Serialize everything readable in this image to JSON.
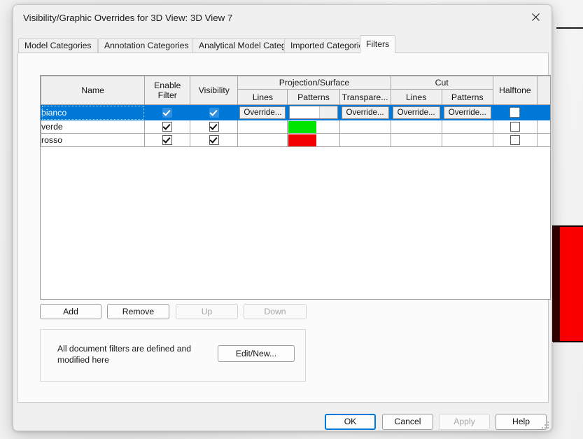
{
  "window": {
    "title": "Visibility/Graphic Overrides for 3D View: 3D View 7",
    "close_icon": "close-icon"
  },
  "tabs": [
    {
      "label": "Model Categories",
      "active": false
    },
    {
      "label": "Annotation Categories",
      "active": false
    },
    {
      "label": "Analytical Model Categories",
      "active": false
    },
    {
      "label": "Imported Categories",
      "active": false
    },
    {
      "label": "Filters",
      "active": true
    }
  ],
  "grid": {
    "group_headers": {
      "name": "Name",
      "enable_filter": "Enable\nFilter",
      "enable_filter_line1": "Enable",
      "enable_filter_line2": "Filter",
      "visibility": "Visibility",
      "projection_surface": "Projection/Surface",
      "cut": "Cut",
      "halftone": "Halftone"
    },
    "sub_headers": {
      "proj_lines": "Lines",
      "proj_patterns": "Patterns",
      "proj_transparency": "Transpare...",
      "cut_lines": "Lines",
      "cut_patterns": "Patterns"
    },
    "override_label": "Override...",
    "rows": [
      {
        "name": "bianco",
        "selected": true,
        "enable_filter": true,
        "visibility": true,
        "proj_lines": "Override...",
        "proj_patterns_swatch": "#ffffff",
        "proj_patterns_is_button": true,
        "proj_transparency": "Override...",
        "cut_lines": "Override...",
        "cut_patterns": "Override...",
        "halftone": false
      },
      {
        "name": "verde",
        "selected": false,
        "enable_filter": true,
        "visibility": true,
        "proj_lines": "",
        "proj_patterns_swatch": "#00e500",
        "proj_patterns_is_button": false,
        "proj_transparency": "",
        "cut_lines": "",
        "cut_patterns": "",
        "halftone": false
      },
      {
        "name": "rosso",
        "selected": false,
        "enable_filter": true,
        "visibility": true,
        "proj_lines": "",
        "proj_patterns_swatch": "#f50000",
        "proj_patterns_is_button": false,
        "proj_transparency": "",
        "cut_lines": "",
        "cut_patterns": "",
        "halftone": false
      }
    ]
  },
  "actions": {
    "add": "Add",
    "remove": "Remove",
    "up": "Up",
    "down": "Down",
    "up_disabled": true,
    "down_disabled": true
  },
  "info_box": {
    "text": "All document filters are defined and modified here",
    "edit_new": "Edit/New..."
  },
  "footer": {
    "ok": "OK",
    "cancel": "Cancel",
    "apply": "Apply",
    "help": "Help",
    "apply_disabled": true
  },
  "colors": {
    "accent": "#0078d7",
    "selection": "#0078d7",
    "green_swatch": "#00e500",
    "red_swatch": "#f50000",
    "white_swatch": "#ffffff",
    "background_solid_red": "#fb0000"
  }
}
